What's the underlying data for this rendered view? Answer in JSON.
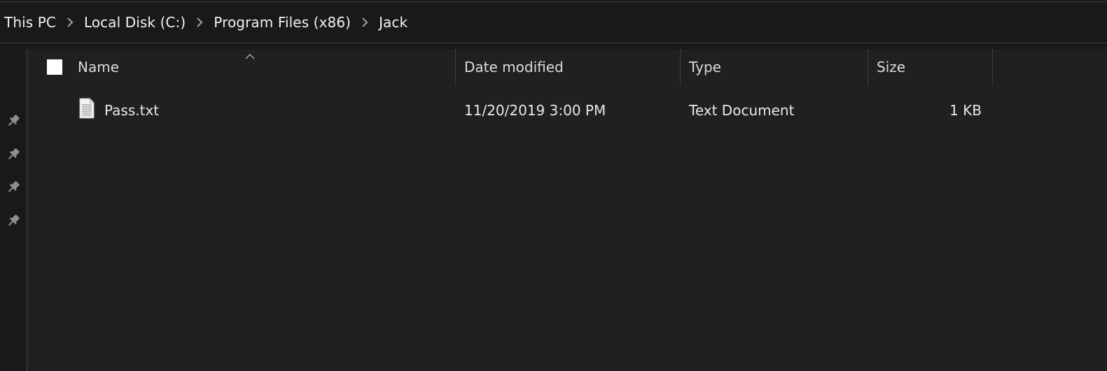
{
  "breadcrumb": {
    "items": [
      "This PC",
      "Local Disk (C:)",
      "Program Files (x86)",
      "Jack"
    ],
    "separator_icon": "chevron-right-icon"
  },
  "nav_pane": {
    "pins": [
      "pin-icon",
      "pin-icon",
      "pin-icon",
      "pin-icon"
    ]
  },
  "columns": {
    "name": "Name",
    "date_modified": "Date modified",
    "type": "Type",
    "size": "Size",
    "sort_indicator_icon": "sort-up-icon"
  },
  "files": [
    {
      "name": "Pass.txt",
      "date_modified": "11/20/2019 3:00 PM",
      "type": "Text Document",
      "size": "1 KB",
      "icon": "text-file-icon"
    }
  ],
  "colors": {
    "background": "#191919",
    "content_background": "#202020",
    "text": "#e8e8e8",
    "divider": "#3d3d3d"
  }
}
